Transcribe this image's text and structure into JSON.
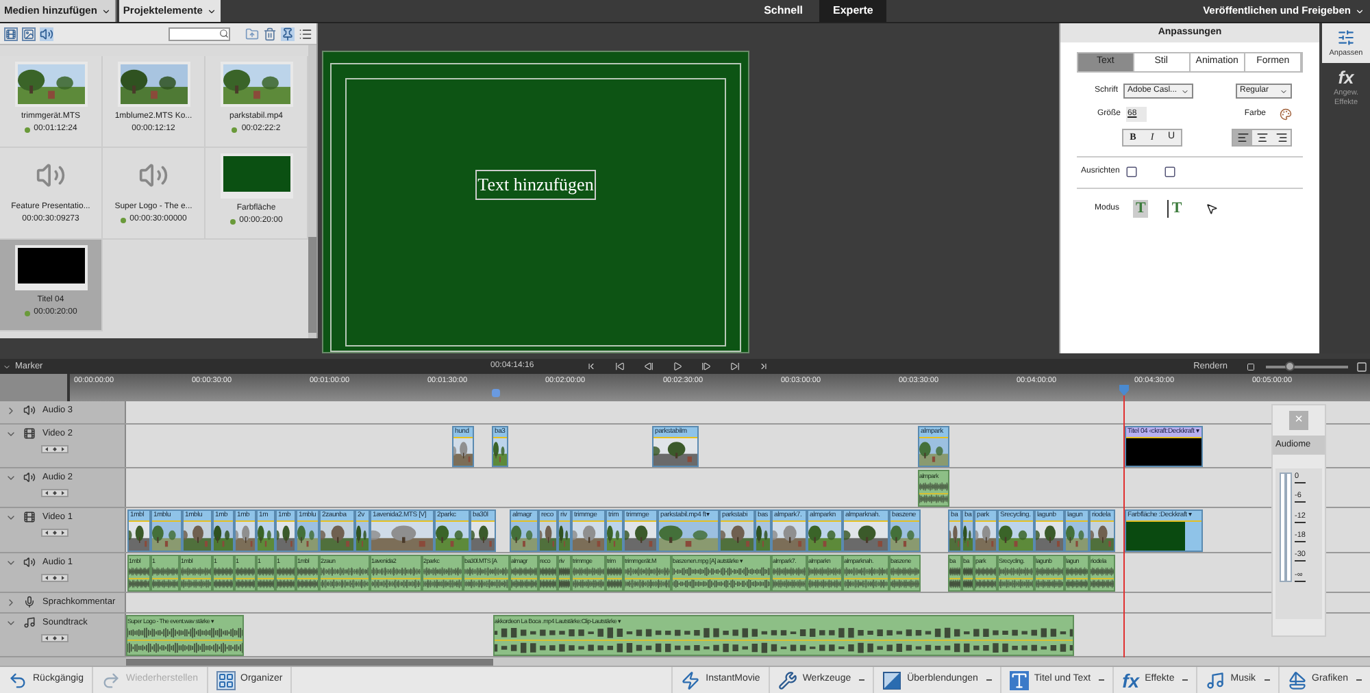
{
  "top_bar": {
    "add_media": "Medien hinzufügen",
    "project_assets": "Projektelemente",
    "modes": [
      {
        "label": "Schnell",
        "selected": false
      },
      {
        "label": "Experte",
        "selected": true
      }
    ],
    "publish": "Veröffentlichen und Freigeben"
  },
  "media_panel": {
    "items": [
      {
        "kind": "video",
        "name": "trimmgerät.MTS",
        "duration": "00:01:12:24",
        "in_use": true,
        "selected": false
      },
      {
        "kind": "video",
        "name": "1mblume2.MTS Ko...",
        "duration": "00:00:12:12",
        "in_use": false,
        "selected": false
      },
      {
        "kind": "video",
        "name": "parkstabil.mp4",
        "duration": "00:02:22:2",
        "in_use": true,
        "selected": false
      },
      {
        "kind": "audio",
        "name": "Feature Presentatio...",
        "duration": "00:00:30:09273",
        "in_use": false,
        "selected": false
      },
      {
        "kind": "audio",
        "name": "Super Logo - The e...",
        "duration": "00:00:30:00000",
        "in_use": true,
        "selected": false
      },
      {
        "kind": "color",
        "name": "Farbfläche",
        "duration": "00:00:20:00",
        "in_use": true,
        "selected": false
      },
      {
        "kind": "title",
        "name": "Titel 04",
        "duration": "00:00:20:00",
        "in_use": true,
        "selected": true
      }
    ]
  },
  "monitor": {
    "title_text": "Text hinzufügen"
  },
  "adjustments": {
    "title": "Anpassungen",
    "tabs": [
      {
        "label": "Text",
        "selected": true
      },
      {
        "label": "Stil",
        "selected": false
      },
      {
        "label": "Animation",
        "selected": false
      },
      {
        "label": "Formen",
        "selected": false
      }
    ],
    "font_label": "Schrift",
    "font": "Adobe Casl...",
    "style": "Regular",
    "size_label": "Größe",
    "size": "68",
    "color_label": "Farbe",
    "format_buttons": [
      {
        "label": "B",
        "kind": "bold"
      },
      {
        "label": "I",
        "kind": "italic"
      },
      {
        "label": "U",
        "kind": "underline"
      }
    ],
    "align": [
      {
        "kind": "left",
        "selected": true
      },
      {
        "kind": "center",
        "selected": false
      },
      {
        "kind": "right",
        "selected": false
      }
    ],
    "arrange_label": "Ausrichten",
    "mode_label": "Modus",
    "modes": [
      {
        "kind": "horizontal",
        "label": "T",
        "selected": true
      },
      {
        "kind": "vertical",
        "label": "T",
        "selected": false
      },
      {
        "kind": "pointer",
        "selected": false
      }
    ]
  },
  "side_panel": [
    {
      "kind": "adjust",
      "label": "Anpassen",
      "selected": true
    },
    {
      "kind": "fx",
      "icon": "fx",
      "label": "Angew. Effekte",
      "selected": false
    }
  ],
  "timeline": {
    "marker": "Marker",
    "timecode": "00:04:14:16",
    "render": "Rendern",
    "zoom": {
      "level": 0.28
    },
    "ruler": [
      "00:00:00:00",
      "00:00:30:00",
      "00:01:00:00",
      "00:01:30:00",
      "00:02:00:00",
      "00:02:30:00",
      "00:03:00:00",
      "00:03:30:00",
      "00:04:00:00",
      "00:04:30:00",
      "00:05:00:00"
    ],
    "tracks": [
      {
        "kind": "audio",
        "name": "Audio 3",
        "expanded": false
      },
      {
        "kind": "video",
        "name": "Video 2",
        "expanded": true,
        "clips": [
          {
            "kind": "video",
            "label": "hund"
          },
          {
            "kind": "video",
            "label": "ba3"
          },
          {
            "kind": "video",
            "label": "parkstabilm"
          },
          {
            "kind": "video",
            "label": "almpark"
          },
          {
            "kind": "title",
            "label": "Titel 04 ‹ckraft:Deckkraft ▾"
          }
        ]
      },
      {
        "kind": "audio",
        "name": "Audio 2",
        "expanded": true,
        "clips": [
          {
            "kind": "audio",
            "label": "almpark"
          }
        ]
      },
      {
        "kind": "video",
        "name": "Video 1",
        "expanded": true,
        "clips": [
          {
            "kind": "video",
            "label": "1mbl"
          },
          {
            "kind": "video",
            "label": "1mblu"
          },
          {
            "kind": "video",
            "label": "1mblu"
          },
          {
            "kind": "video",
            "label": "1mb"
          },
          {
            "kind": "video",
            "label": "1mb"
          },
          {
            "kind": "video",
            "label": "1m"
          },
          {
            "kind": "video",
            "label": "1mb"
          },
          {
            "kind": "video",
            "label": "1mblu"
          },
          {
            "kind": "video",
            "label": "2zaunba"
          },
          {
            "kind": "video",
            "label": "2v"
          },
          {
            "kind": "video",
            "label": "1avenida2.MTS [V]"
          },
          {
            "kind": "video",
            "label": "2parkc"
          },
          {
            "kind": "video",
            "label": "ba30l"
          },
          {
            "kind": "video",
            "label": "almagr"
          },
          {
            "kind": "video",
            "label": "reco"
          },
          {
            "kind": "video",
            "label": "riv"
          },
          {
            "kind": "video",
            "label": "trimmge"
          },
          {
            "kind": "video",
            "label": "trim"
          },
          {
            "kind": "video",
            "label": "trimmge"
          },
          {
            "kind": "video",
            "label": "parkstabil.mp4 ft▾"
          },
          {
            "kind": "video",
            "label": "parkstabi"
          },
          {
            "kind": "video",
            "label": "bas"
          },
          {
            "kind": "video",
            "label": "almpark7."
          },
          {
            "kind": "video",
            "label": "almparkn"
          },
          {
            "kind": "video",
            "label": "almparknah."
          },
          {
            "kind": "video",
            "label": "baszene"
          },
          {
            "kind": "video",
            "label": "ba"
          },
          {
            "kind": "video",
            "label": "ba"
          },
          {
            "kind": "video",
            "label": "park"
          },
          {
            "kind": "video",
            "label": "Srecycling."
          },
          {
            "kind": "video",
            "label": "lagunb"
          },
          {
            "kind": "video",
            "label": "lagun"
          },
          {
            "kind": "video",
            "label": "riodela"
          },
          {
            "kind": "color",
            "label": "Farbfläche :Deckkraft ▾"
          }
        ]
      },
      {
        "kind": "audio",
        "name": "Audio 1",
        "expanded": true,
        "clips": [
          {
            "kind": "audio",
            "label": "1mbl"
          },
          {
            "kind": "audio",
            "label": "1"
          },
          {
            "kind": "audio",
            "label": "1mbl"
          },
          {
            "kind": "audio",
            "label": "1"
          },
          {
            "kind": "audio",
            "label": "1"
          },
          {
            "kind": "audio",
            "label": "1"
          },
          {
            "kind": "audio",
            "label": "1"
          },
          {
            "kind": "audio",
            "label": "1mbl"
          },
          {
            "kind": "audio",
            "label": "2zaun"
          },
          {
            "kind": "audio",
            "label": "1avenida2"
          },
          {
            "kind": "audio",
            "label": "2parkc"
          },
          {
            "kind": "audio",
            "label": "ba30l.MTS [A"
          },
          {
            "kind": "audio",
            "label": "almagr"
          },
          {
            "kind": "audio",
            "label": "reco"
          },
          {
            "kind": "audio",
            "label": "riv"
          },
          {
            "kind": "audio",
            "label": "trimmge"
          },
          {
            "kind": "audio",
            "label": "trim"
          },
          {
            "kind": "audio",
            "label": "trimmgerät.M"
          },
          {
            "kind": "audio",
            "label": "baszenen.mpg [A] autstärke ▾"
          },
          {
            "kind": "audio",
            "label": "almpark7."
          },
          {
            "kind": "audio",
            "label": "almparkn"
          },
          {
            "kind": "audio",
            "label": "almparknah."
          },
          {
            "kind": "audio",
            "label": "baszene"
          },
          {
            "kind": "audio",
            "label": "ba"
          },
          {
            "kind": "audio",
            "label": "ba"
          },
          {
            "kind": "audio",
            "label": "park"
          },
          {
            "kind": "audio",
            "label": "Srecycling."
          },
          {
            "kind": "audio",
            "label": "lagunb"
          },
          {
            "kind": "audio",
            "label": "lagun"
          },
          {
            "kind": "audio",
            "label": "riodela"
          }
        ]
      },
      {
        "kind": "voice",
        "name": "Sprachkommentar",
        "expanded": false
      },
      {
        "kind": "music",
        "name": "Soundtrack",
        "expanded": true,
        "clips": [
          {
            "kind": "audio",
            "label": "Super Logo - The event.wav stärke ▾"
          },
          {
            "kind": "audio",
            "label": "akkordeon La Boca .mp4 Lautstärke:Clip-Lautstärke ▾"
          }
        ]
      }
    ]
  },
  "audio_meter": {
    "close": "×",
    "title": "Audiome",
    "scale": [
      "0",
      "-6",
      "-12",
      "-18",
      "-30",
      "-∞"
    ]
  },
  "bottom_bar": {
    "left": [
      {
        "kind": "undo",
        "label": "Rückgängig",
        "disabled": false
      },
      {
        "kind": "redo",
        "label": "Wiederherstellen",
        "disabled": true
      },
      {
        "kind": "organizer",
        "label": "Organizer",
        "disabled": false
      }
    ],
    "right": [
      {
        "kind": "instant",
        "label": "InstantMovie",
        "menu": false
      },
      {
        "kind": "tools",
        "label": "Werkzeuge",
        "menu": true
      },
      {
        "kind": "transitions",
        "label": "Überblendungen",
        "menu": true
      },
      {
        "kind": "titles",
        "label": "Titel und Text",
        "menu": true
      },
      {
        "kind": "effects",
        "icon": "fx",
        "label": "Effekte",
        "menu": true
      },
      {
        "kind": "music",
        "label": "Musik",
        "menu": true
      },
      {
        "kind": "graphics",
        "label": "Grafiken",
        "menu": true
      }
    ]
  }
}
